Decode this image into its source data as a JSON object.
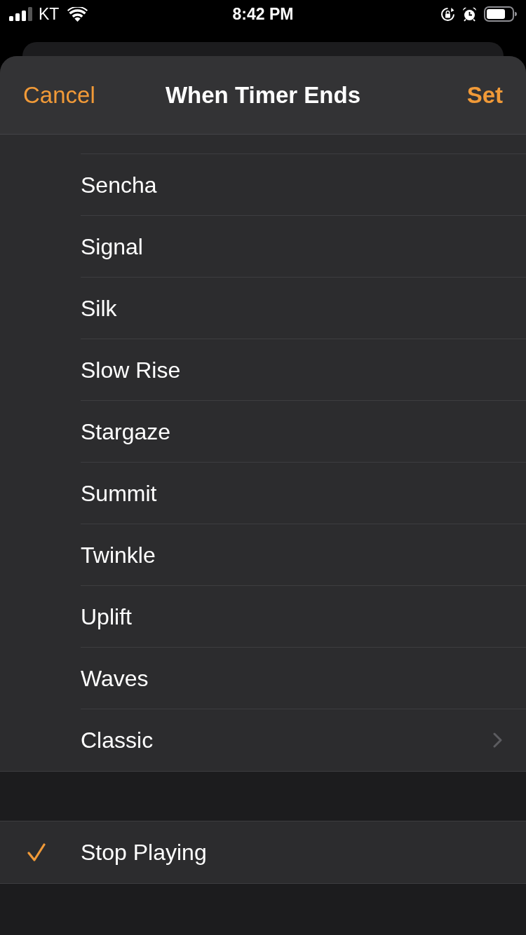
{
  "status_bar": {
    "carrier": "KT",
    "time": "8:42 PM"
  },
  "sheet": {
    "cancel": "Cancel",
    "title": "When Timer Ends",
    "set": "Set"
  },
  "sounds": [
    {
      "label": "Sencha",
      "kind": "tone",
      "selected": false
    },
    {
      "label": "Signal",
      "kind": "tone",
      "selected": false
    },
    {
      "label": "Silk",
      "kind": "tone",
      "selected": false
    },
    {
      "label": "Slow Rise",
      "kind": "tone",
      "selected": false
    },
    {
      "label": "Stargaze",
      "kind": "tone",
      "selected": false
    },
    {
      "label": "Summit",
      "kind": "tone",
      "selected": false
    },
    {
      "label": "Twinkle",
      "kind": "tone",
      "selected": false
    },
    {
      "label": "Uplift",
      "kind": "tone",
      "selected": false
    },
    {
      "label": "Waves",
      "kind": "tone",
      "selected": false
    },
    {
      "label": "Classic",
      "kind": "group",
      "selected": false
    }
  ],
  "end_actions": [
    {
      "label": "Stop Playing",
      "selected": true
    }
  ]
}
